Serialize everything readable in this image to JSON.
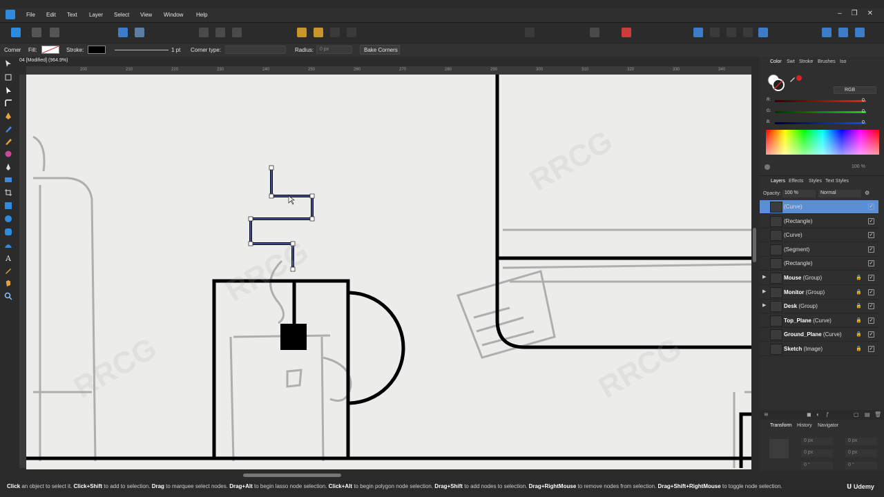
{
  "menu": [
    "File",
    "Edit",
    "Text",
    "Layer",
    "Select",
    "View",
    "Window",
    "Help"
  ],
  "context_bar": {
    "tool_name": "Corner",
    "fill_label": "Fill:",
    "stroke_label": "Stroke:",
    "stroke_width": "1 pt",
    "corner_type_label": "Corner type:",
    "radius_label": "Radius:",
    "radius_value": "0 px",
    "bake_corners_label": "Bake Corners"
  },
  "document": {
    "tab_title": "04 [Modified] (964.9%)",
    "ruler_ticks": [
      "200",
      "210",
      "220",
      "230",
      "240",
      "250",
      "260",
      "270",
      "280",
      "290",
      "300",
      "310",
      "320",
      "330",
      "340",
      "350"
    ]
  },
  "color_panel": {
    "tabs": [
      "Color",
      "Swt",
      "Stroke",
      "Brushes",
      "Iso"
    ],
    "mode": "RGB",
    "channels": [
      {
        "label": "R:",
        "value": "0",
        "color": "#d42a2a"
      },
      {
        "label": "G:",
        "value": "0",
        "color": "#2aa82a"
      },
      {
        "label": "B:",
        "value": "0",
        "color": "#2a55d4"
      }
    ],
    "opacity_value": "100 %"
  },
  "layers_panel": {
    "tabs": [
      "Layers",
      "Effects",
      "Styles",
      "Text Styles"
    ],
    "opacity_label": "Opacity:",
    "opacity_value": "100 %",
    "blend_mode": "Normal",
    "layers": [
      {
        "name": "(Curve)",
        "type": "",
        "selected": true,
        "group": false,
        "locked": false
      },
      {
        "name": "(Rectangle)",
        "type": "",
        "selected": false,
        "group": false,
        "locked": false
      },
      {
        "name": "(Curve)",
        "type": "",
        "selected": false,
        "group": false,
        "locked": false
      },
      {
        "name": "(Segment)",
        "type": "",
        "selected": false,
        "group": false,
        "locked": false
      },
      {
        "name": "(Rectangle)",
        "type": "",
        "selected": false,
        "group": false,
        "locked": false
      },
      {
        "name": "Mouse",
        "type": "(Group)",
        "selected": false,
        "group": true,
        "locked": true
      },
      {
        "name": "Monitor",
        "type": "(Group)",
        "selected": false,
        "group": true,
        "locked": true
      },
      {
        "name": "Desk",
        "type": "(Group)",
        "selected": false,
        "group": true,
        "locked": true
      },
      {
        "name": "Top_Plane",
        "type": "(Curve)",
        "selected": false,
        "group": false,
        "locked": true
      },
      {
        "name": "Ground_Plane",
        "type": "(Curve)",
        "selected": false,
        "group": false,
        "locked": true
      },
      {
        "name": "Sketch",
        "type": "(Image)",
        "selected": false,
        "group": false,
        "locked": true
      }
    ]
  },
  "transform_panel": {
    "tabs": [
      "Transform",
      "History",
      "Navigator"
    ],
    "fields": [
      "0 px",
      "0 px",
      "0 px",
      "0 px",
      "0 °",
      "0 °"
    ]
  },
  "status_bar": [
    {
      "bold": "Click",
      "text": " an object to select it. "
    },
    {
      "bold": "Click+Shift",
      "text": " to add to selection. "
    },
    {
      "bold": "Drag",
      "text": " to marquee select nodes. "
    },
    {
      "bold": "Drag+Alt",
      "text": " to begin lasso node selection. "
    },
    {
      "bold": "Click+Alt",
      "text": " to begin polygon node selection. "
    },
    {
      "bold": "Drag+Shift",
      "text": " to add nodes to selection. "
    },
    {
      "bold": "Drag+RightMouse",
      "text": " to remove nodes from selection. "
    },
    {
      "bold": "Drag+Shift+RightMouse",
      "text": " to toggle node selection."
    }
  ],
  "watermark": "RRCG",
  "udemy_label": "Udemy"
}
